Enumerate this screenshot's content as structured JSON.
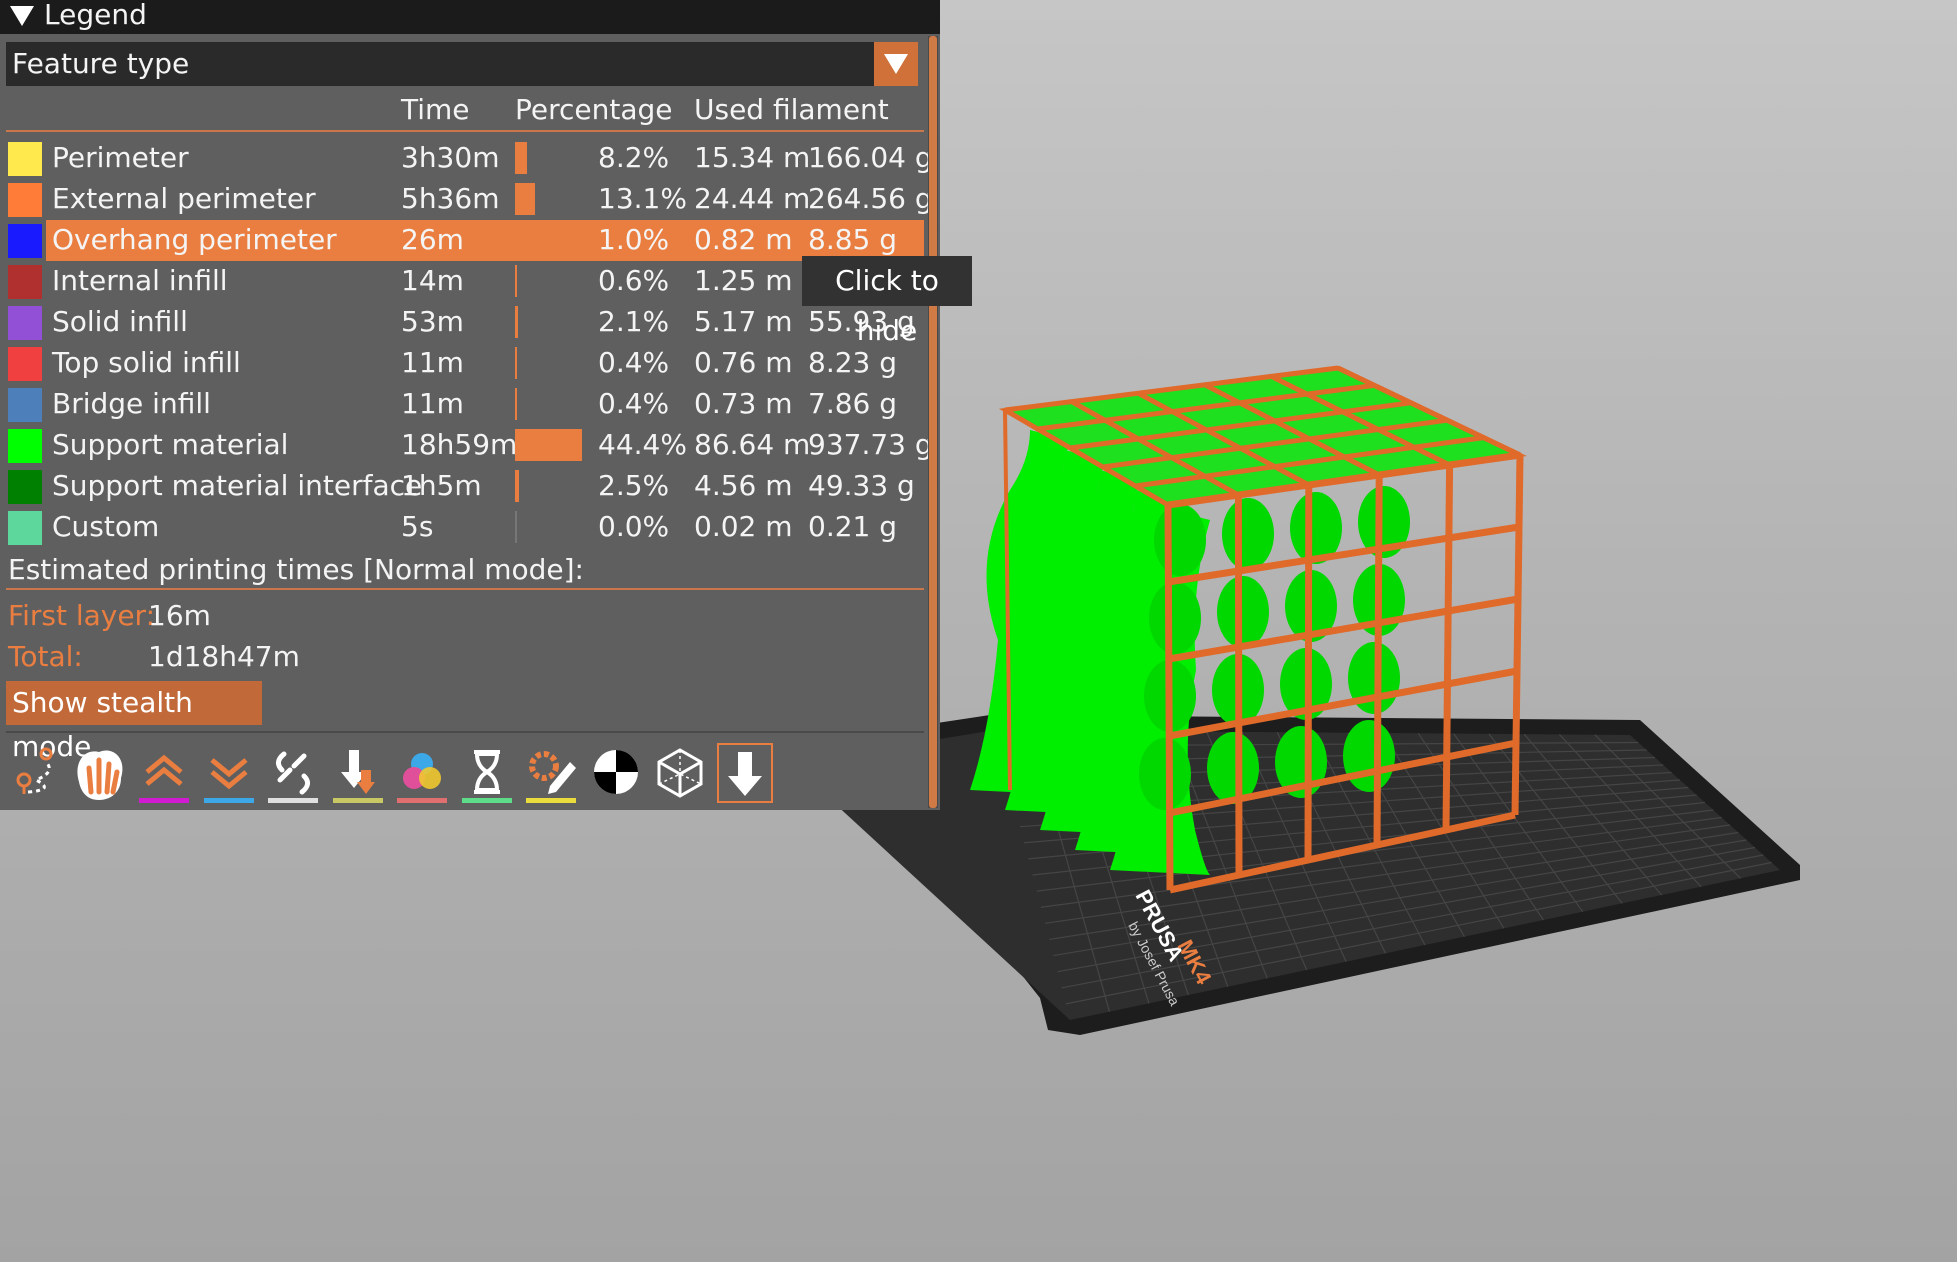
{
  "legend": {
    "title": "Legend",
    "view_type": "Feature type",
    "headers": {
      "time": "Time",
      "percentage": "Percentage",
      "used_filament": "Used filament"
    },
    "rows": [
      {
        "label": "Perimeter",
        "color": "#ffe94c",
        "time": "3h30m",
        "percent": "8.2%",
        "fraction": 0.082,
        "length": "15.34 m",
        "weight": "166.04 g"
      },
      {
        "label": "External perimeter",
        "color": "#ff7b38",
        "time": "5h36m",
        "percent": "13.1%",
        "fraction": 0.131,
        "length": "24.44 m",
        "weight": "264.56 g"
      },
      {
        "label": "Overhang perimeter",
        "color": "#1a1aff",
        "time": "26m",
        "percent": "1.0%",
        "fraction": 0.01,
        "length": "0.82 m",
        "weight": "8.85 g"
      },
      {
        "label": "Internal infill",
        "color": "#b03030",
        "time": "14m",
        "percent": "0.6%",
        "fraction": 0.006,
        "length": "1.25 m",
        "weight": ""
      },
      {
        "label": "Solid infill",
        "color": "#9150d6",
        "time": "53m",
        "percent": "2.1%",
        "fraction": 0.021,
        "length": "5.17 m",
        "weight": "55.93 g"
      },
      {
        "label": "Top solid infill",
        "color": "#f04040",
        "time": "11m",
        "percent": "0.4%",
        "fraction": 0.004,
        "length": "0.76 m",
        "weight": "8.23 g"
      },
      {
        "label": "Bridge infill",
        "color": "#4d80ba",
        "time": "11m",
        "percent": "0.4%",
        "fraction": 0.004,
        "length": "0.73 m",
        "weight": "7.86 g"
      },
      {
        "label": "Support material",
        "color": "#00ff00",
        "time": "18h59m",
        "percent": "44.4%",
        "fraction": 0.444,
        "length": "86.64 m",
        "weight": "937.73 g"
      },
      {
        "label": "Support material interface",
        "color": "#008000",
        "time": "1h5m",
        "percent": "2.5%",
        "fraction": 0.025,
        "length": "4.56 m",
        "weight": "49.33 g"
      },
      {
        "label": "Custom",
        "color": "#5ed79c",
        "time": "5s",
        "percent": "0.0%",
        "fraction": 0.0,
        "length": "0.02 m",
        "weight": "0.21 g"
      }
    ],
    "selected_row": 2,
    "estimated_title": "Estimated printing times [Normal mode]:",
    "first_layer_label": "First layer:",
    "first_layer_value": "16m",
    "total_label": "Total:",
    "total_value": "1d18h47m",
    "stealth_button": "Show stealth mode",
    "toolbar": [
      "travel-icon",
      "hand-icon",
      "layers-up-icon",
      "layers-down-icon",
      "broken-link-icon",
      "tool-change-icon",
      "color-change-icon",
      "pause-icon",
      "custom-gcode-icon",
      "center-of-gravity-icon",
      "shells-icon",
      "tool-marker-icon"
    ],
    "toolbar_underlines": [
      "",
      "",
      "#d11ad1",
      "#3da8e8",
      "#e0e0e0",
      "#c8c864",
      "#e07070",
      "#5fdc8a",
      "#eadc3c",
      "",
      "",
      ""
    ]
  },
  "tooltip": "Click to hide",
  "bed": {
    "brand": "PRUSA",
    "model": "MK4",
    "byline": "by Josef Prusa"
  },
  "colors": {
    "accent": "#ea7e40",
    "panel": "#5f5f5f",
    "support": "#00ee00",
    "perimeter": "#e06a2a"
  }
}
